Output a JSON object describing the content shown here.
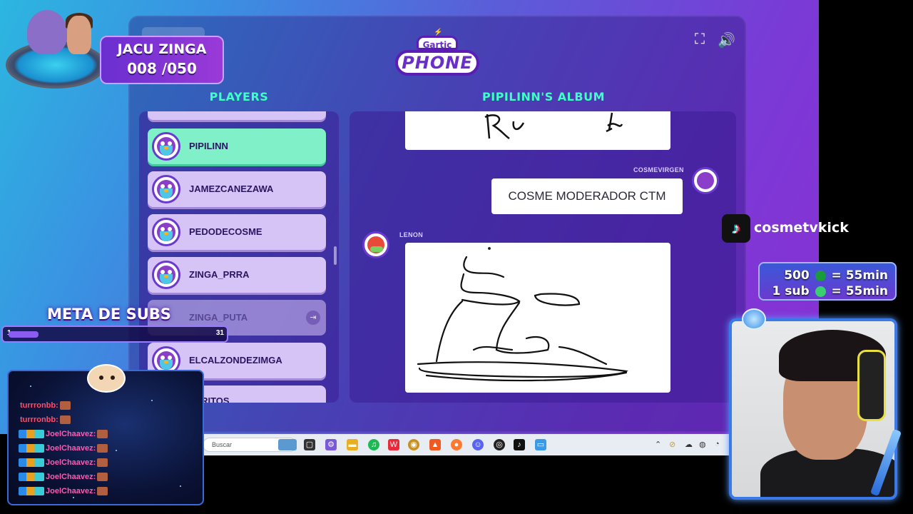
{
  "overlay": {
    "goal_title": "JACU ZINGA",
    "goal_count": "008 /050",
    "meta_label": "META DE SUBS",
    "meta_min": "1",
    "meta_max": "31",
    "meta_progress": 0.14,
    "tiktok_handle": "cosmetvkick",
    "reward_1": "500",
    "reward_1_suffix": "= 55min",
    "reward_2": "1 sub",
    "reward_2_suffix": "= 55min"
  },
  "game": {
    "logo_top": "Gartic",
    "logo_main": "PHONE",
    "players_title": "PLAYERS",
    "album_title": "PIPILINN'S ALBUM",
    "players": [
      {
        "name": "PIPILINN",
        "state": "active"
      },
      {
        "name": "JAMEZCANEZAWA",
        "state": "normal"
      },
      {
        "name": "PEDODECOSME",
        "state": "normal"
      },
      {
        "name": "ZINGA_PRRA",
        "state": "normal"
      },
      {
        "name": "ZINGA_PUTA",
        "state": "left"
      },
      {
        "name": "ELCALZONDEZIMGA",
        "state": "normal"
      },
      {
        "name": "PARITOS",
        "state": "normal"
      }
    ],
    "album": {
      "text_author": "COSMEVIRGEN",
      "text_entry": "COSME MODERADOR CTM",
      "drawing_author": "LENON"
    }
  },
  "taskbar": {
    "search_placeholder": "Buscar"
  },
  "chat": [
    {
      "user": "turrronbb:",
      "badges": false
    },
    {
      "user": "turrronbb:",
      "badges": false
    },
    {
      "user": "JoelChaavez:",
      "badges": true
    },
    {
      "user": "JoelChaavez:",
      "badges": true
    },
    {
      "user": "JoelChaavez:",
      "badges": true
    },
    {
      "user": "JoelChaavez:",
      "badges": true
    },
    {
      "user": "JoelChaavez:",
      "badges": true
    }
  ],
  "colors": {
    "accent_green": "#3effc6",
    "active_player": "#7ff0c8",
    "player_card": "#d7c4f6",
    "panel": "#3c1e96"
  },
  "icons": [
    "fullscreen-icon",
    "volume-icon",
    "exit-icon",
    "tiktok-icon",
    "xbox-icon",
    "sub-icon"
  ]
}
